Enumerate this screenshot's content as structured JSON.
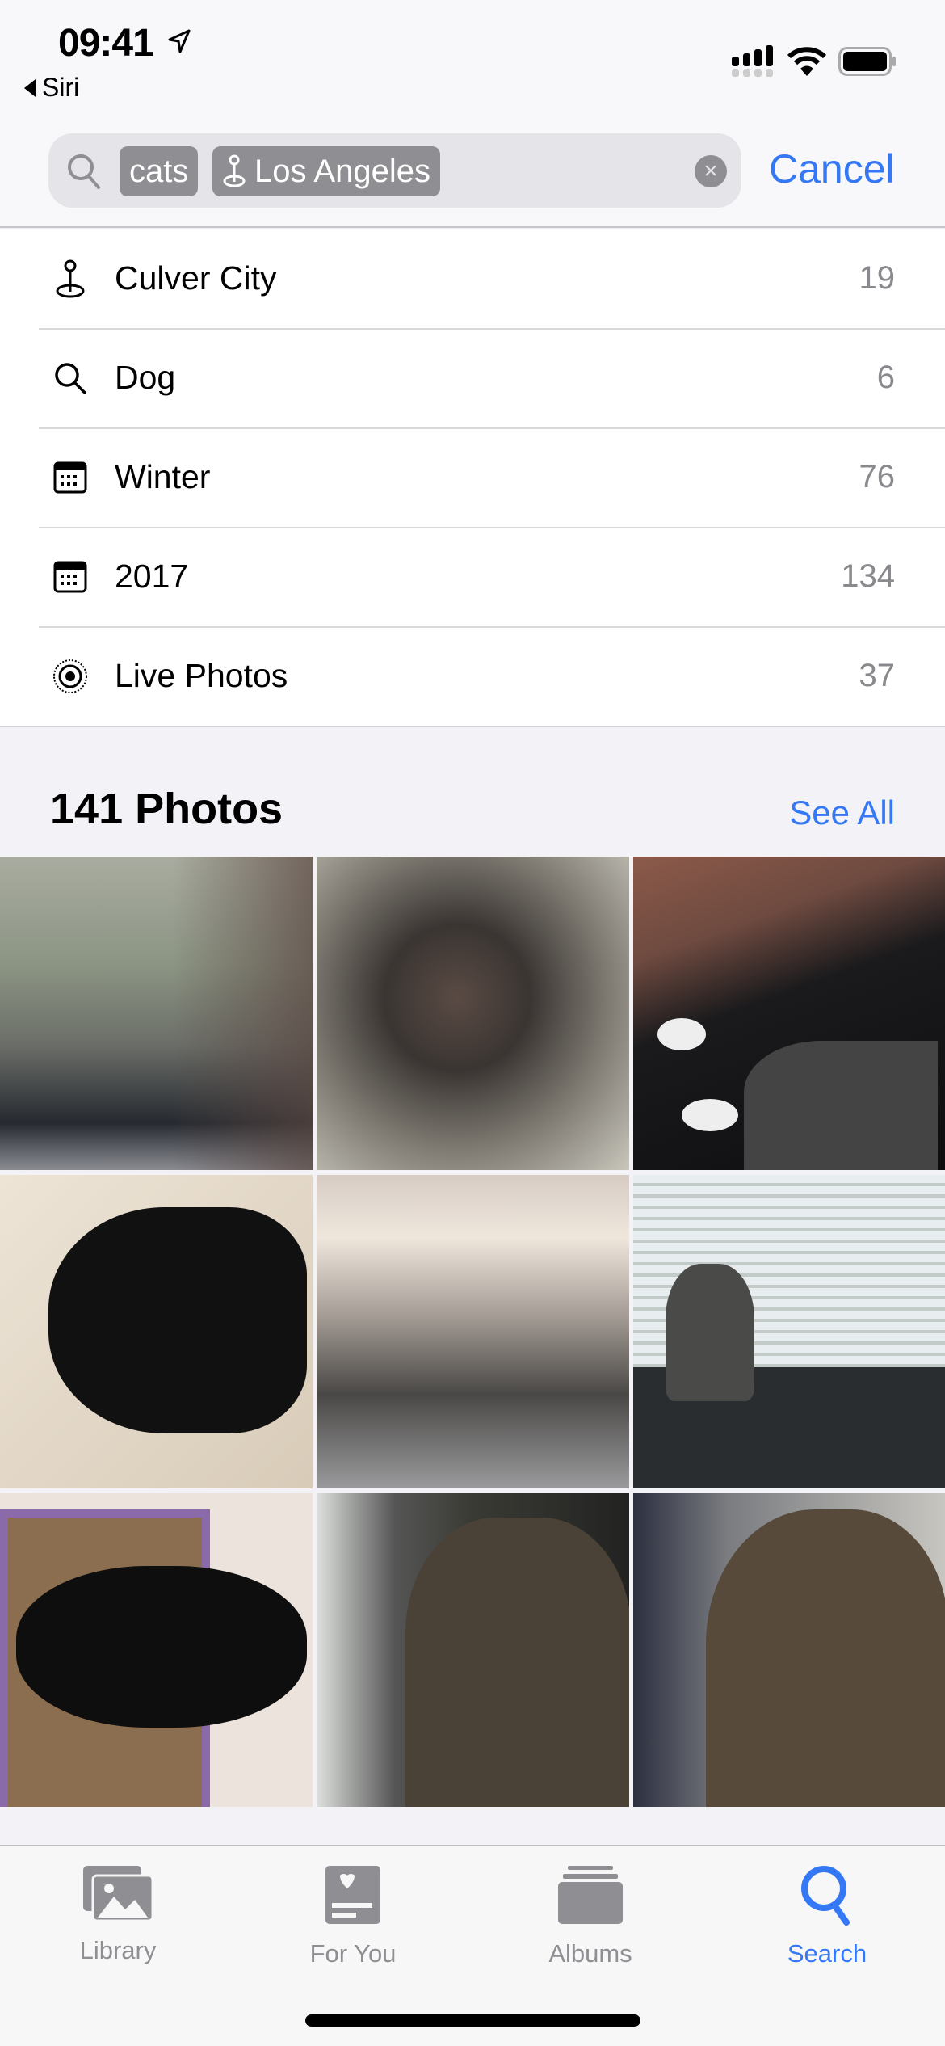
{
  "status_bar": {
    "time": "09:41",
    "back_app": "Siri"
  },
  "search": {
    "tokens": [
      {
        "label": "cats",
        "icon": "none"
      },
      {
        "label": "Los Angeles",
        "icon": "location-pin-icon"
      }
    ],
    "cancel_label": "Cancel"
  },
  "suggestions": [
    {
      "icon": "location-pin-icon",
      "label": "Culver City",
      "count": "19"
    },
    {
      "icon": "search-icon",
      "label": "Dog",
      "count": "6"
    },
    {
      "icon": "calendar-icon",
      "label": "Winter",
      "count": "76"
    },
    {
      "icon": "calendar-icon",
      "label": "2017",
      "count": "134"
    },
    {
      "icon": "live-photo-icon",
      "label": "Live Photos",
      "count": "37"
    }
  ],
  "photos": {
    "title": "141 Photos",
    "see_all": "See All"
  },
  "tabs": [
    {
      "label": "Library",
      "icon": "photos-library-icon",
      "active": false
    },
    {
      "label": "For You",
      "icon": "for-you-icon",
      "active": false
    },
    {
      "label": "Albums",
      "icon": "albums-icon",
      "active": false
    },
    {
      "label": "Search",
      "icon": "search-icon",
      "active": true
    }
  ],
  "colors": {
    "accent": "#3478f6",
    "inactive": "#8e8e93"
  }
}
